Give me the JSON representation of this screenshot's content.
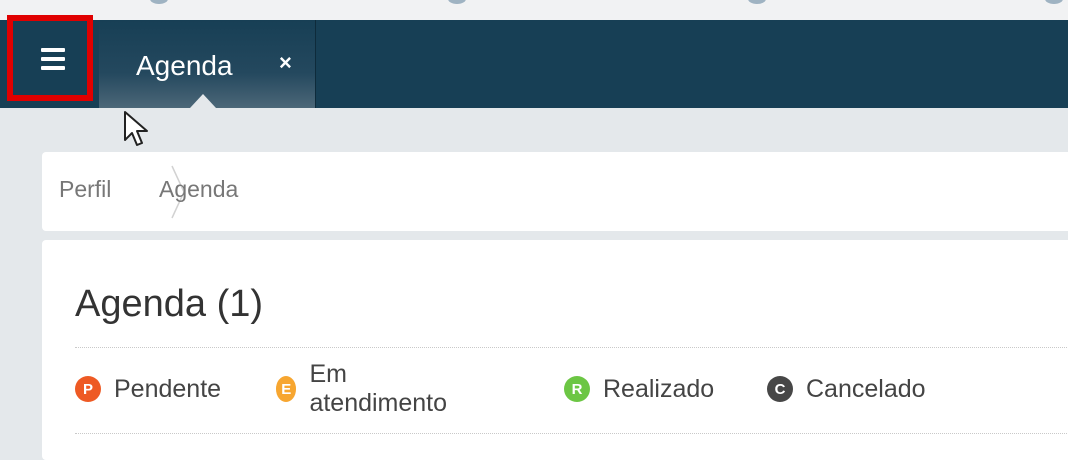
{
  "header": {
    "tab": {
      "label": "Agenda",
      "close": "×"
    }
  },
  "breadcrumb": {
    "items": [
      "Perfil",
      "Agenda"
    ]
  },
  "main": {
    "title": "Agenda (1)",
    "legend": [
      {
        "letter": "P",
        "label": "Pendente",
        "color": "#ee5a24"
      },
      {
        "letter": "E",
        "label": "Em atendimento",
        "color": "#f7a630"
      },
      {
        "letter": "R",
        "label": "Realizado",
        "color": "#6cc644"
      },
      {
        "letter": "C",
        "label": "Cancelado",
        "color": "#474747"
      }
    ]
  },
  "colors": {
    "topbar": "#173f55",
    "highlight": "#e00000",
    "background": "#e4e8eb"
  },
  "icons": {
    "menu": "hamburger-icon",
    "cursor": "mouse-pointer-icon",
    "separator": "chevron-right-icon"
  }
}
